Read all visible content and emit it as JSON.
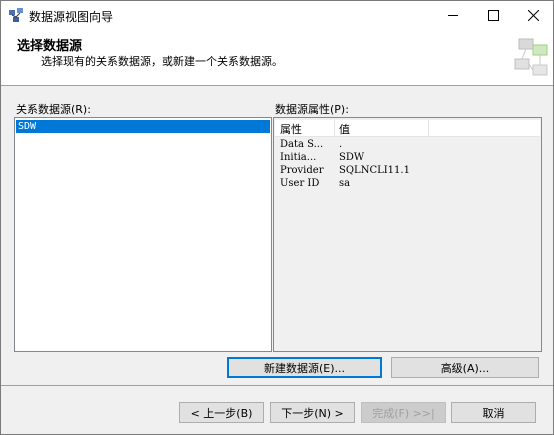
{
  "window": {
    "title": "数据源视图向导"
  },
  "header": {
    "title": "选择数据源",
    "subtitle": "选择现有的关系数据源，或新建一个关系数据源。"
  },
  "relational": {
    "label": "关系数据源(R):",
    "items": [
      "SDW"
    ]
  },
  "properties": {
    "label": "数据源属性(P):",
    "col_property": "属性",
    "col_value": "值",
    "rows": [
      {
        "name": "Data S...",
        "value": "."
      },
      {
        "name": "Initia...",
        "value": "SDW"
      },
      {
        "name": "Provider",
        "value": "SQLNCLI11.1"
      },
      {
        "name": "User ID",
        "value": "sa"
      }
    ]
  },
  "buttons": {
    "new_datasource": "新建数据源(E)...",
    "advanced": "高级(A)...",
    "back": "< 上一步(B)",
    "next": "下一步(N) >",
    "finish": "完成(F) >>|",
    "cancel": "取消"
  },
  "icons": {
    "app": "wizard-icon",
    "minimize": "minimize-icon",
    "maximize": "maximize-icon",
    "close": "close-icon",
    "header_graphic": "datasource-graphic-icon"
  }
}
